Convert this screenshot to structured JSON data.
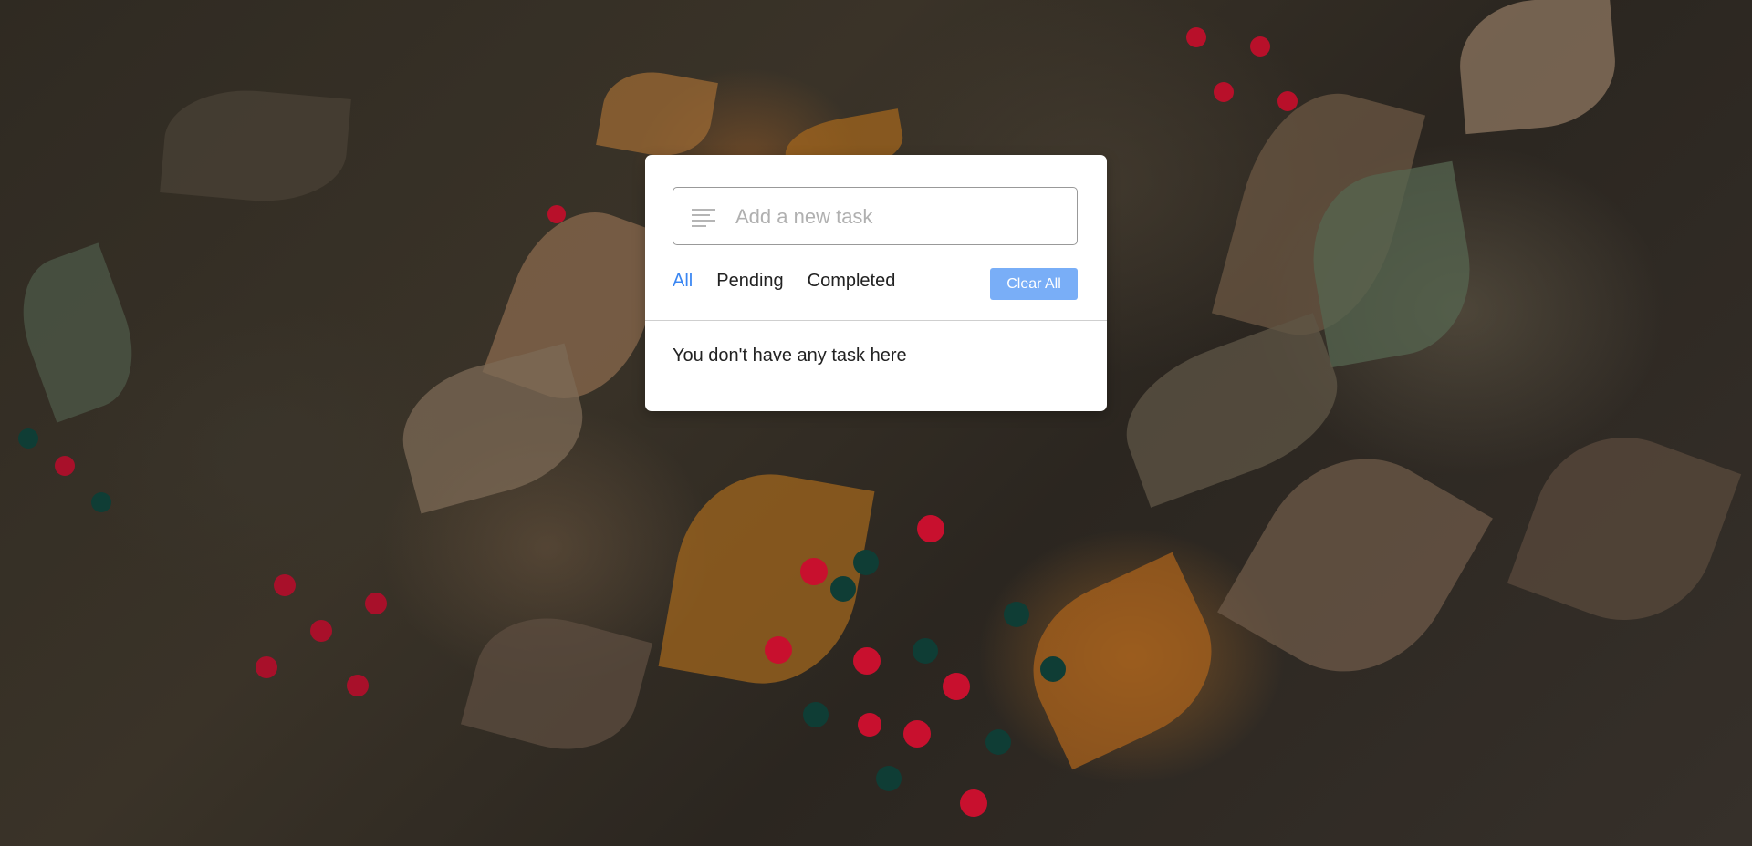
{
  "task_input": {
    "placeholder": "Add a new task",
    "value": ""
  },
  "filters": {
    "all_label": "All",
    "pending_label": "Pending",
    "completed_label": "Completed",
    "active": "All",
    "active_color": "#3a86f2"
  },
  "clear_button": {
    "label": "Clear All",
    "color": "#79aef7"
  },
  "task_list": {
    "empty_message": "You don't have any task here"
  },
  "icons": {
    "input_icon": "align-left-icon"
  },
  "background": {
    "description_colors": [
      "#2f2a22",
      "#b06e28",
      "#6e6450",
      "#c8102e",
      "#0f3d35"
    ]
  }
}
